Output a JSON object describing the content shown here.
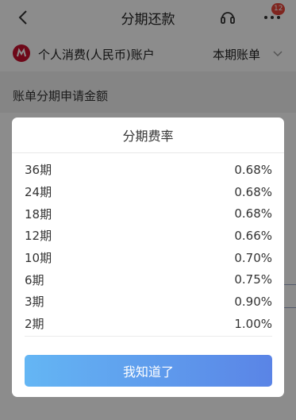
{
  "nav": {
    "title": "分期还款",
    "badge_count": "12"
  },
  "account": {
    "name": "个人消费(人民币)账户",
    "bill_type": "本期账单"
  },
  "section": {
    "label": "账单分期申请金额"
  },
  "modal": {
    "title": "分期费率",
    "rates": [
      {
        "term": "36期",
        "rate": "0.68%"
      },
      {
        "term": "24期",
        "rate": "0.68%"
      },
      {
        "term": "18期",
        "rate": "0.68%"
      },
      {
        "term": "12期",
        "rate": "0.66%"
      },
      {
        "term": "10期",
        "rate": "0.70%"
      },
      {
        "term": "6期",
        "rate": "0.75%"
      },
      {
        "term": "3期",
        "rate": "0.90%"
      },
      {
        "term": "2期",
        "rate": "1.00%"
      }
    ],
    "confirm_label": "我知道了"
  },
  "colors": {
    "brand_red": "#c8102e",
    "button_gradient_start": "#64b6f4",
    "button_gradient_end": "#5a84e6",
    "badge": "#e8443a"
  },
  "icons": {
    "back": "back-chevron-icon",
    "service": "headset-icon",
    "more": "more-dots-icon",
    "bank": "bank-logo-icon",
    "dropdown": "chevron-down-icon"
  }
}
